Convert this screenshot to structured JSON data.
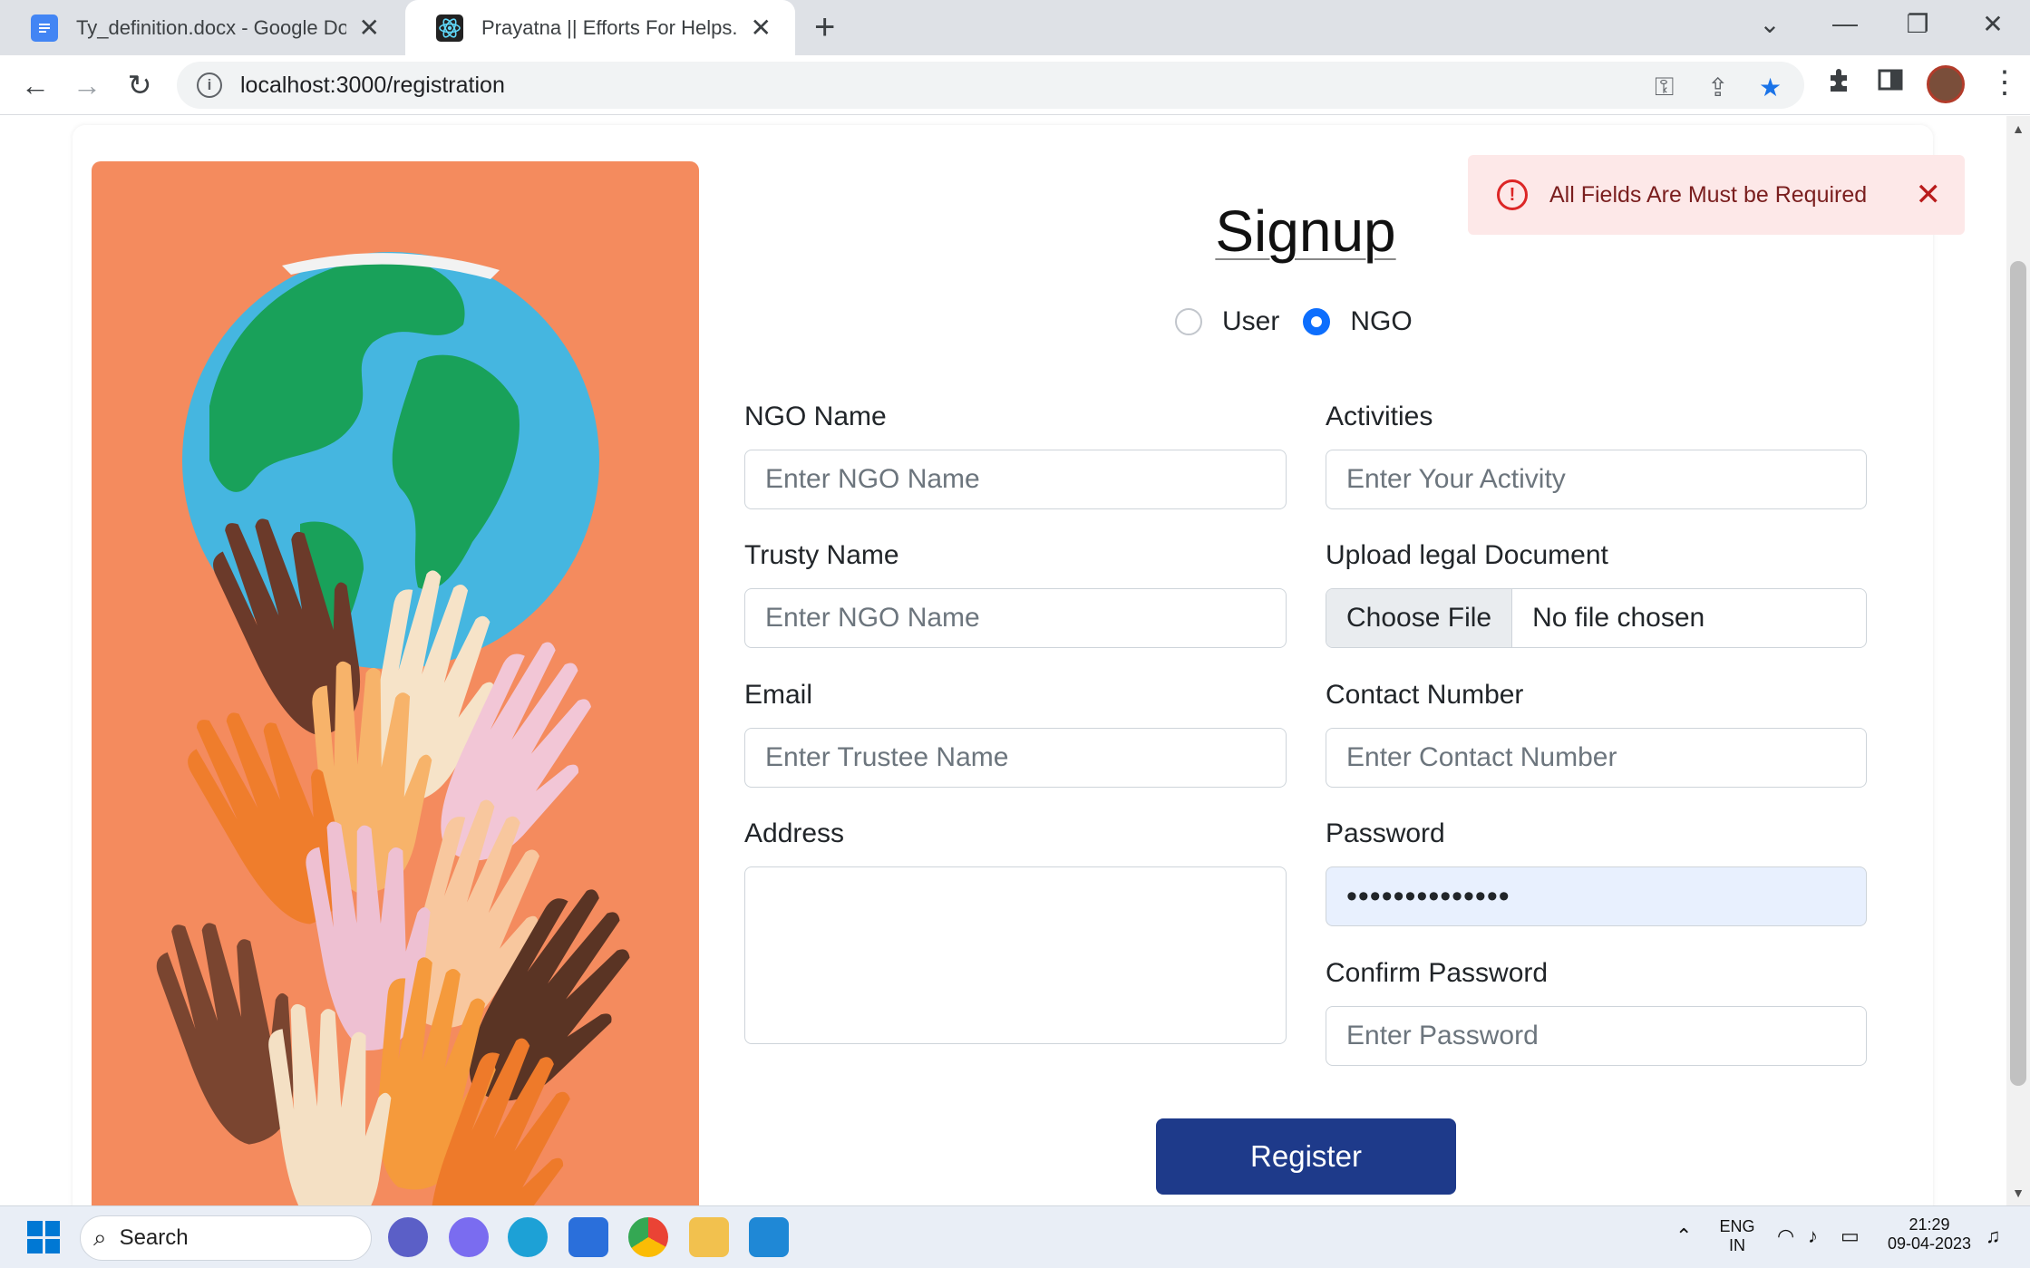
{
  "browser": {
    "tabs": [
      {
        "title": "Ty_definition.docx - Google Docs",
        "active": false
      },
      {
        "title": "Prayatna || Efforts For Helps.",
        "active": true
      }
    ],
    "url": "localhost:3000/registration"
  },
  "page": {
    "title": "Signup",
    "role_options": [
      {
        "label": "User",
        "selected": false
      },
      {
        "label": "NGO",
        "selected": true
      }
    ],
    "fields": {
      "ngo_name": {
        "label": "NGO Name",
        "placeholder": "Enter NGO Name"
      },
      "activities": {
        "label": "Activities",
        "placeholder": "Enter Your Activity"
      },
      "trusty_name": {
        "label": "Trusty Name",
        "placeholder": "Enter NGO Name"
      },
      "legal_document": {
        "label": "Upload legal Document",
        "button": "Choose File",
        "status": "No file chosen"
      },
      "email": {
        "label": "Email",
        "placeholder": "Enter Trustee Name"
      },
      "contact": {
        "label": "Contact Number",
        "placeholder": "Enter Contact Number"
      },
      "address": {
        "label": "Address",
        "placeholder": ""
      },
      "password": {
        "label": "Password",
        "value": "••••••••••••••"
      },
      "confirm_password": {
        "label": "Confirm Password",
        "placeholder": "Enter Password"
      }
    },
    "register_label": "Register",
    "toast": {
      "message": "All Fields Are Must be Required"
    }
  },
  "taskbar": {
    "search_label": "Search",
    "lang_top": "ENG",
    "lang_bottom": "IN",
    "time": "21:29",
    "date": "09-04-2023"
  },
  "colors": {
    "accent": "#0d6efd",
    "register_button": "#1e3a8a",
    "hero_background": "#f48b5e",
    "toast_background": "#fde8e8",
    "toast_icon": "#dc2626"
  }
}
